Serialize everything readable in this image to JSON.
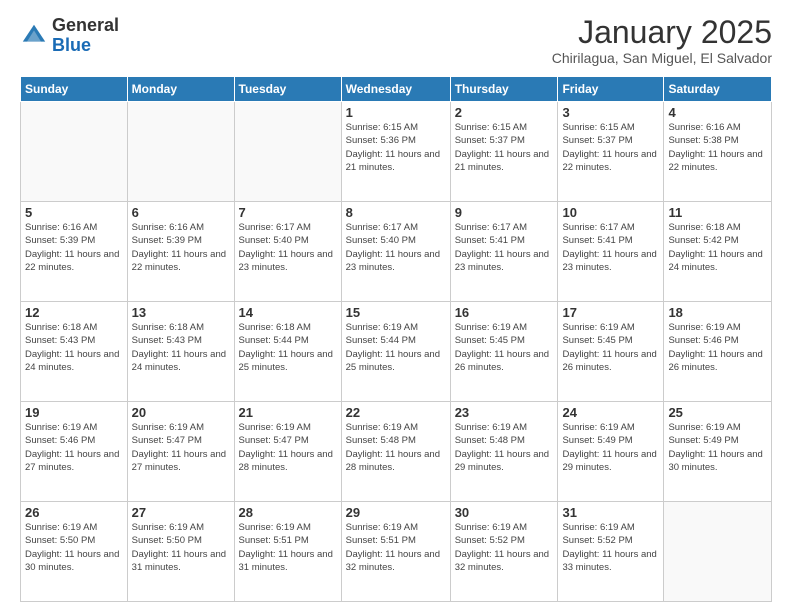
{
  "header": {
    "logo_general": "General",
    "logo_blue": "Blue",
    "month_title": "January 2025",
    "location": "Chirilagua, San Miguel, El Salvador"
  },
  "weekdays": [
    "Sunday",
    "Monday",
    "Tuesday",
    "Wednesday",
    "Thursday",
    "Friday",
    "Saturday"
  ],
  "weeks": [
    [
      {
        "day": "",
        "sunrise": "",
        "sunset": "",
        "daylight": "",
        "empty": true
      },
      {
        "day": "",
        "sunrise": "",
        "sunset": "",
        "daylight": "",
        "empty": true
      },
      {
        "day": "",
        "sunrise": "",
        "sunset": "",
        "daylight": "",
        "empty": true
      },
      {
        "day": "1",
        "sunrise": "Sunrise: 6:15 AM",
        "sunset": "Sunset: 5:36 PM",
        "daylight": "Daylight: 11 hours and 21 minutes."
      },
      {
        "day": "2",
        "sunrise": "Sunrise: 6:15 AM",
        "sunset": "Sunset: 5:37 PM",
        "daylight": "Daylight: 11 hours and 21 minutes."
      },
      {
        "day": "3",
        "sunrise": "Sunrise: 6:15 AM",
        "sunset": "Sunset: 5:37 PM",
        "daylight": "Daylight: 11 hours and 22 minutes."
      },
      {
        "day": "4",
        "sunrise": "Sunrise: 6:16 AM",
        "sunset": "Sunset: 5:38 PM",
        "daylight": "Daylight: 11 hours and 22 minutes."
      }
    ],
    [
      {
        "day": "5",
        "sunrise": "Sunrise: 6:16 AM",
        "sunset": "Sunset: 5:39 PM",
        "daylight": "Daylight: 11 hours and 22 minutes."
      },
      {
        "day": "6",
        "sunrise": "Sunrise: 6:16 AM",
        "sunset": "Sunset: 5:39 PM",
        "daylight": "Daylight: 11 hours and 22 minutes."
      },
      {
        "day": "7",
        "sunrise": "Sunrise: 6:17 AM",
        "sunset": "Sunset: 5:40 PM",
        "daylight": "Daylight: 11 hours and 23 minutes."
      },
      {
        "day": "8",
        "sunrise": "Sunrise: 6:17 AM",
        "sunset": "Sunset: 5:40 PM",
        "daylight": "Daylight: 11 hours and 23 minutes."
      },
      {
        "day": "9",
        "sunrise": "Sunrise: 6:17 AM",
        "sunset": "Sunset: 5:41 PM",
        "daylight": "Daylight: 11 hours and 23 minutes."
      },
      {
        "day": "10",
        "sunrise": "Sunrise: 6:17 AM",
        "sunset": "Sunset: 5:41 PM",
        "daylight": "Daylight: 11 hours and 23 minutes."
      },
      {
        "day": "11",
        "sunrise": "Sunrise: 6:18 AM",
        "sunset": "Sunset: 5:42 PM",
        "daylight": "Daylight: 11 hours and 24 minutes."
      }
    ],
    [
      {
        "day": "12",
        "sunrise": "Sunrise: 6:18 AM",
        "sunset": "Sunset: 5:43 PM",
        "daylight": "Daylight: 11 hours and 24 minutes."
      },
      {
        "day": "13",
        "sunrise": "Sunrise: 6:18 AM",
        "sunset": "Sunset: 5:43 PM",
        "daylight": "Daylight: 11 hours and 24 minutes."
      },
      {
        "day": "14",
        "sunrise": "Sunrise: 6:18 AM",
        "sunset": "Sunset: 5:44 PM",
        "daylight": "Daylight: 11 hours and 25 minutes."
      },
      {
        "day": "15",
        "sunrise": "Sunrise: 6:19 AM",
        "sunset": "Sunset: 5:44 PM",
        "daylight": "Daylight: 11 hours and 25 minutes."
      },
      {
        "day": "16",
        "sunrise": "Sunrise: 6:19 AM",
        "sunset": "Sunset: 5:45 PM",
        "daylight": "Daylight: 11 hours and 26 minutes."
      },
      {
        "day": "17",
        "sunrise": "Sunrise: 6:19 AM",
        "sunset": "Sunset: 5:45 PM",
        "daylight": "Daylight: 11 hours and 26 minutes."
      },
      {
        "day": "18",
        "sunrise": "Sunrise: 6:19 AM",
        "sunset": "Sunset: 5:46 PM",
        "daylight": "Daylight: 11 hours and 26 minutes."
      }
    ],
    [
      {
        "day": "19",
        "sunrise": "Sunrise: 6:19 AM",
        "sunset": "Sunset: 5:46 PM",
        "daylight": "Daylight: 11 hours and 27 minutes."
      },
      {
        "day": "20",
        "sunrise": "Sunrise: 6:19 AM",
        "sunset": "Sunset: 5:47 PM",
        "daylight": "Daylight: 11 hours and 27 minutes."
      },
      {
        "day": "21",
        "sunrise": "Sunrise: 6:19 AM",
        "sunset": "Sunset: 5:47 PM",
        "daylight": "Daylight: 11 hours and 28 minutes."
      },
      {
        "day": "22",
        "sunrise": "Sunrise: 6:19 AM",
        "sunset": "Sunset: 5:48 PM",
        "daylight": "Daylight: 11 hours and 28 minutes."
      },
      {
        "day": "23",
        "sunrise": "Sunrise: 6:19 AM",
        "sunset": "Sunset: 5:48 PM",
        "daylight": "Daylight: 11 hours and 29 minutes."
      },
      {
        "day": "24",
        "sunrise": "Sunrise: 6:19 AM",
        "sunset": "Sunset: 5:49 PM",
        "daylight": "Daylight: 11 hours and 29 minutes."
      },
      {
        "day": "25",
        "sunrise": "Sunrise: 6:19 AM",
        "sunset": "Sunset: 5:49 PM",
        "daylight": "Daylight: 11 hours and 30 minutes."
      }
    ],
    [
      {
        "day": "26",
        "sunrise": "Sunrise: 6:19 AM",
        "sunset": "Sunset: 5:50 PM",
        "daylight": "Daylight: 11 hours and 30 minutes."
      },
      {
        "day": "27",
        "sunrise": "Sunrise: 6:19 AM",
        "sunset": "Sunset: 5:50 PM",
        "daylight": "Daylight: 11 hours and 31 minutes."
      },
      {
        "day": "28",
        "sunrise": "Sunrise: 6:19 AM",
        "sunset": "Sunset: 5:51 PM",
        "daylight": "Daylight: 11 hours and 31 minutes."
      },
      {
        "day": "29",
        "sunrise": "Sunrise: 6:19 AM",
        "sunset": "Sunset: 5:51 PM",
        "daylight": "Daylight: 11 hours and 32 minutes."
      },
      {
        "day": "30",
        "sunrise": "Sunrise: 6:19 AM",
        "sunset": "Sunset: 5:52 PM",
        "daylight": "Daylight: 11 hours and 32 minutes."
      },
      {
        "day": "31",
        "sunrise": "Sunrise: 6:19 AM",
        "sunset": "Sunset: 5:52 PM",
        "daylight": "Daylight: 11 hours and 33 minutes."
      },
      {
        "day": "",
        "sunrise": "",
        "sunset": "",
        "daylight": "",
        "empty": true
      }
    ]
  ]
}
